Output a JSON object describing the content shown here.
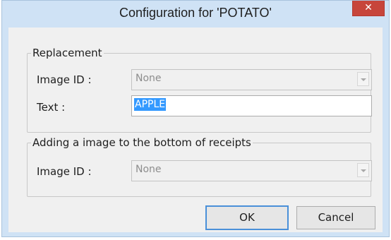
{
  "window": {
    "title": "Configuration for 'POTATO'",
    "close_symbol": "✕"
  },
  "replacement": {
    "group_title": "Replacement",
    "image_id_label": "Image  ID :",
    "image_id_value": "None",
    "text_label": "Text :",
    "text_value": "APPLE"
  },
  "bottom_image": {
    "group_title": "Adding a image to the bottom of receipts",
    "image_id_label": "Image  ID :",
    "image_id_value": "None"
  },
  "buttons": {
    "ok_label": "OK",
    "cancel_label": "Cancel"
  },
  "icons": {
    "close": "close-icon",
    "dropdown": "chevron-down-icon"
  },
  "colors": {
    "frame": "#cfe2f5",
    "close_button": "#c7453b",
    "selection": "#3399ff",
    "default_button_border": "#4a90d9"
  }
}
